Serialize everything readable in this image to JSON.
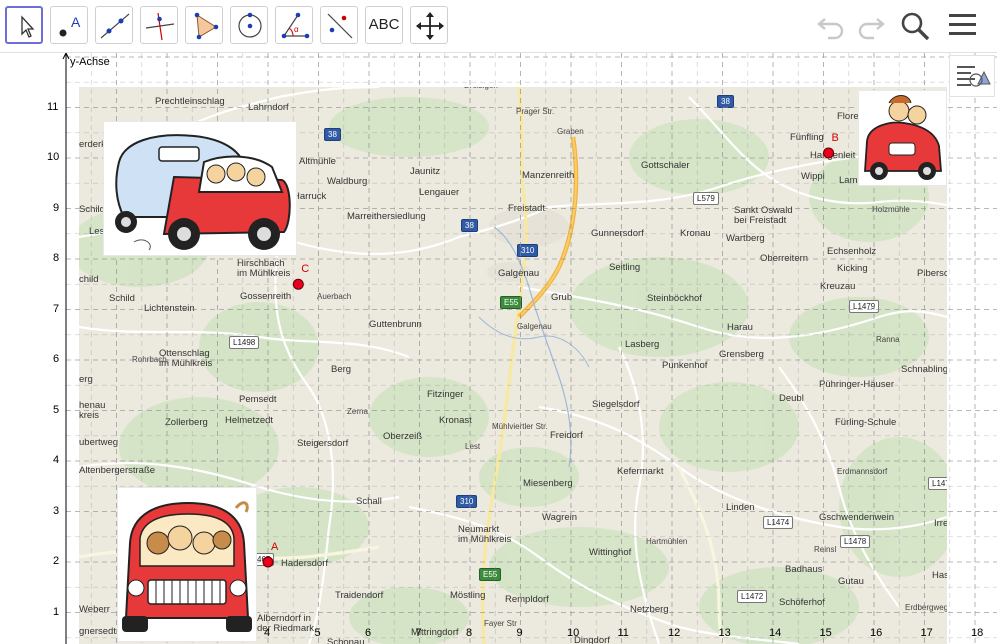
{
  "toolbar": {
    "text_tool_label": "ABC",
    "tools": [
      "move-tool",
      "point-tool",
      "line-tool",
      "perpendicular-tool",
      "polygon-tool",
      "circle-tool",
      "angle-tool",
      "reflect-tool",
      "text-tool",
      "move-graphics-tool"
    ],
    "active_tool": "move-tool"
  },
  "axes": {
    "y_label": "y-Achse",
    "x_ticks": [
      "4",
      "5",
      "6",
      "7",
      "8",
      "9",
      "10",
      "11",
      "12",
      "13",
      "14",
      "15",
      "16",
      "17",
      "18"
    ],
    "y_ticks": [
      "1",
      "2",
      "3",
      "4",
      "5",
      "6",
      "7",
      "8",
      "9",
      "10",
      "11"
    ]
  },
  "points": [
    {
      "label": "A",
      "x": 4,
      "y": 2
    },
    {
      "label": "B",
      "x": 15.1,
      "y": 10.1
    },
    {
      "label": "C",
      "x": 4.6,
      "y": 7.5
    }
  ],
  "colors": {
    "accent": "#6e6ed8",
    "point": "#e8001c",
    "road_major": "#f4b240",
    "road_minor": "#ffffff",
    "map_bg": "#ece9de",
    "forest": "#cfe3c2"
  },
  "map": {
    "towns": [
      {
        "t": "Prechtleinschlag",
        "x": 76,
        "y": 10
      },
      {
        "t": "Lahrndorf",
        "x": 169,
        "y": 16
      },
      {
        "t": "Altmühle",
        "x": 220,
        "y": 70
      },
      {
        "t": "Harruck",
        "x": 214,
        "y": 105
      },
      {
        "t": "Waldburg",
        "x": 248,
        "y": 90
      },
      {
        "t": "Jaunitz",
        "x": 331,
        "y": 80
      },
      {
        "t": "Lengauer",
        "x": 340,
        "y": 101
      },
      {
        "t": "Manzenreith",
        "x": 443,
        "y": 84
      },
      {
        "t": "Gottschaler",
        "x": 562,
        "y": 74
      },
      {
        "t": "Fünfling",
        "x": 711,
        "y": 46
      },
      {
        "t": "Hangenleit",
        "x": 731,
        "y": 64
      },
      {
        "t": "Wippl",
        "x": 722,
        "y": 85
      },
      {
        "t": "Lam",
        "x": 760,
        "y": 89
      },
      {
        "t": "Flore",
        "x": 758,
        "y": 25
      },
      {
        "t": "Marreithersiedlung",
        "x": 268,
        "y": 125
      },
      {
        "t": "Freistadt",
        "x": 429,
        "y": 117
      },
      {
        "t": "Gunnersdorf",
        "x": 512,
        "y": 142
      },
      {
        "t": "Kronau",
        "x": 601,
        "y": 142
      },
      {
        "t": "Wartberg",
        "x": 647,
        "y": 147
      },
      {
        "t": "Sankt Oswald\nbei Freistadt",
        "x": 655,
        "y": 119
      },
      {
        "t": "Echsenholz",
        "x": 748,
        "y": 160
      },
      {
        "t": "Oberreitern",
        "x": 681,
        "y": 167
      },
      {
        "t": "Kicking",
        "x": 758,
        "y": 177
      },
      {
        "t": "Pibersc",
        "x": 838,
        "y": 182
      },
      {
        "t": "Kreuzau",
        "x": 741,
        "y": 195
      },
      {
        "t": "Hirschbach\nim Mühlkreis",
        "x": 158,
        "y": 172
      },
      {
        "t": "Gossenreith",
        "x": 161,
        "y": 205
      },
      {
        "t": "Galgenau",
        "x": 419,
        "y": 182
      },
      {
        "t": "Seitling",
        "x": 530,
        "y": 176
      },
      {
        "t": "Grub",
        "x": 472,
        "y": 206
      },
      {
        "t": "Steinböckhof",
        "x": 568,
        "y": 207
      },
      {
        "t": "child",
        "x": 0,
        "y": 188
      },
      {
        "t": "Schild",
        "x": 30,
        "y": 207
      },
      {
        "t": "Lichtenstein",
        "x": 65,
        "y": 217
      },
      {
        "t": "Guttenbrunn",
        "x": 290,
        "y": 233
      },
      {
        "t": "Harau",
        "x": 648,
        "y": 236
      },
      {
        "t": "Lasberg",
        "x": 546,
        "y": 253
      },
      {
        "t": "Grensberg",
        "x": 640,
        "y": 263
      },
      {
        "t": "Ottenschlag\nim Mühlkreis",
        "x": 80,
        "y": 262
      },
      {
        "t": "Berg",
        "x": 252,
        "y": 278
      },
      {
        "t": "Punkenhof",
        "x": 583,
        "y": 274
      },
      {
        "t": "Schnabling",
        "x": 822,
        "y": 278
      },
      {
        "t": "Pühringer-Häuser",
        "x": 740,
        "y": 293
      },
      {
        "t": "erg",
        "x": 0,
        "y": 288
      },
      {
        "t": "Fitzinger",
        "x": 348,
        "y": 303
      },
      {
        "t": "Deubl",
        "x": 700,
        "y": 307
      },
      {
        "t": "Pemsedt",
        "x": 160,
        "y": 308
      },
      {
        "t": "henau\nkreis",
        "x": 0,
        "y": 314
      },
      {
        "t": "Siegelsdorf",
        "x": 513,
        "y": 313
      },
      {
        "t": "Zollerberg",
        "x": 86,
        "y": 331
      },
      {
        "t": "Helmetzedt",
        "x": 146,
        "y": 329
      },
      {
        "t": "Kronast",
        "x": 360,
        "y": 329
      },
      {
        "t": "Fürling-Schule",
        "x": 756,
        "y": 331
      },
      {
        "t": "Oberzeiß",
        "x": 304,
        "y": 345
      },
      {
        "t": "Freidorf",
        "x": 471,
        "y": 344
      },
      {
        "t": "Steigersdorf",
        "x": 218,
        "y": 352
      },
      {
        "t": "ubertweg",
        "x": 0,
        "y": 351
      },
      {
        "t": "Kefermarkt",
        "x": 538,
        "y": 380
      },
      {
        "t": "Altenbergerstraße",
        "x": 0,
        "y": 379
      },
      {
        "t": "Miesenberg",
        "x": 444,
        "y": 392
      },
      {
        "t": "Schall",
        "x": 277,
        "y": 410
      },
      {
        "t": "Linden",
        "x": 647,
        "y": 416
      },
      {
        "t": "Wagrein",
        "x": 463,
        "y": 426
      },
      {
        "t": "Gschwendenwein",
        "x": 740,
        "y": 426
      },
      {
        "t": "Neumarkt\nim Mühlkreis",
        "x": 379,
        "y": 438
      },
      {
        "t": "Irre",
        "x": 855,
        "y": 432
      },
      {
        "t": "Wittinghof",
        "x": 510,
        "y": 461
      },
      {
        "t": "Hadersdorf",
        "x": 202,
        "y": 472
      },
      {
        "t": "Badhaus",
        "x": 706,
        "y": 478
      },
      {
        "t": "Has",
        "x": 853,
        "y": 484
      },
      {
        "t": "Traidendorf",
        "x": 256,
        "y": 504
      },
      {
        "t": "Möstling",
        "x": 371,
        "y": 504
      },
      {
        "t": "Rempldorf",
        "x": 426,
        "y": 508
      },
      {
        "t": "Gutau",
        "x": 759,
        "y": 490
      },
      {
        "t": "Schöferhof",
        "x": 700,
        "y": 511
      },
      {
        "t": "Netzberg",
        "x": 551,
        "y": 518
      },
      {
        "t": "Weberr",
        "x": 0,
        "y": 518
      },
      {
        "t": "Alberndorf in\nder Riedmark",
        "x": 178,
        "y": 527
      },
      {
        "t": "gnersedt",
        "x": 0,
        "y": 540
      },
      {
        "t": "Mittringdorf",
        "x": 332,
        "y": 541
      },
      {
        "t": "Dingdorf",
        "x": 495,
        "y": 549
      },
      {
        "t": "Schonau",
        "x": 248,
        "y": 551
      },
      {
        "t": "Schild",
        "x": 0,
        "y": 118
      },
      {
        "t": "Lesseberg",
        "x": 10,
        "y": 140
      },
      {
        "t": "erderk",
        "x": 0,
        "y": 53
      }
    ],
    "road_labels": [
      {
        "t": "Graben",
        "x": 478,
        "y": 40
      },
      {
        "t": "Auerbach",
        "x": 238,
        "y": 205
      },
      {
        "t": "Rohrbach",
        "x": 53,
        "y": 268
      },
      {
        "t": "Zerna",
        "x": 268,
        "y": 320
      },
      {
        "t": "Galgenau",
        "x": 438,
        "y": 235
      },
      {
        "t": "Mühlviertler Str.",
        "x": 413,
        "y": 335
      },
      {
        "t": "Hartmühlen",
        "x": 567,
        "y": 450
      },
      {
        "t": "Holzmühle",
        "x": 793,
        "y": 118
      },
      {
        "t": "Erdmannsdorf",
        "x": 758,
        "y": 380
      },
      {
        "t": "Ranna",
        "x": 797,
        "y": 248
      },
      {
        "t": "Reinsl",
        "x": 735,
        "y": 458
      },
      {
        "t": "Lest",
        "x": 386,
        "y": 355
      },
      {
        "t": "Prager Str.",
        "x": 437,
        "y": 20
      },
      {
        "t": "Dreisigen",
        "x": 385,
        "y": -6
      },
      {
        "t": "Fayer Str",
        "x": 405,
        "y": 532
      },
      {
        "t": "Erdbergweg",
        "x": 826,
        "y": 516
      }
    ],
    "shields": [
      {
        "t": "38",
        "x": 245,
        "y": 41,
        "c": "blue"
      },
      {
        "t": "38",
        "x": 382,
        "y": 132,
        "c": "blue"
      },
      {
        "t": "38",
        "x": 638,
        "y": 8,
        "c": "blue"
      },
      {
        "t": "310",
        "x": 438,
        "y": 157,
        "c": "blue"
      },
      {
        "t": "310",
        "x": 377,
        "y": 408,
        "c": "blue"
      },
      {
        "t": "E55",
        "x": 421,
        "y": 209,
        "c": "green"
      },
      {
        "t": "E55",
        "x": 400,
        "y": 481,
        "c": "green"
      },
      {
        "t": "L579",
        "x": 614,
        "y": 105,
        "c": ""
      },
      {
        "t": "L1479",
        "x": 770,
        "y": 213,
        "c": ""
      },
      {
        "t": "L1498",
        "x": 150,
        "y": 249,
        "c": ""
      },
      {
        "t": "L1474",
        "x": 684,
        "y": 429,
        "c": ""
      },
      {
        "t": "L1478",
        "x": 761,
        "y": 448,
        "c": ""
      },
      {
        "t": "L1472",
        "x": 658,
        "y": 503,
        "c": ""
      },
      {
        "t": "L147",
        "x": 849,
        "y": 390,
        "c": ""
      },
      {
        "t": "465",
        "x": 174,
        "y": 466,
        "c": ""
      }
    ]
  }
}
